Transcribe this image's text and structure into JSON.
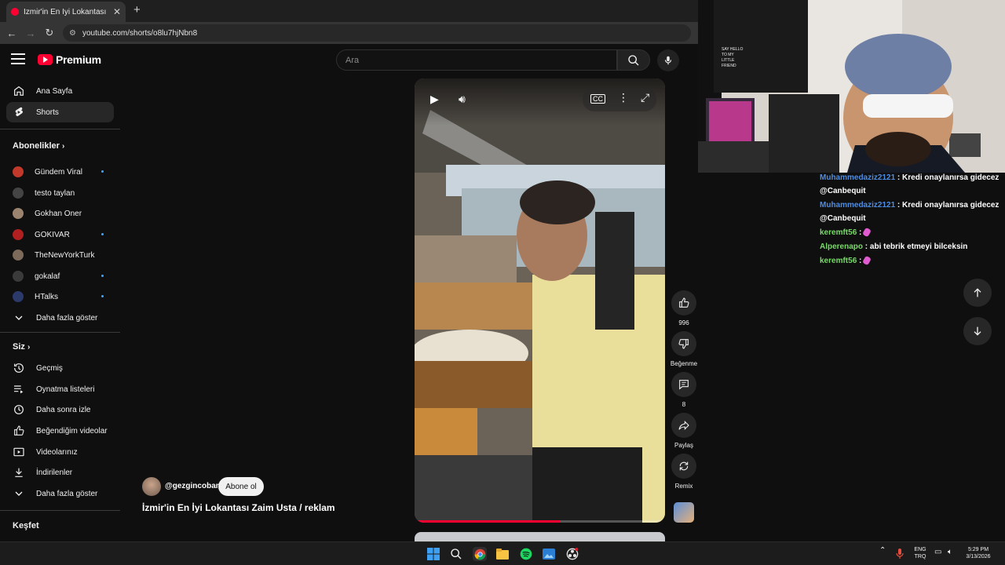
{
  "browser": {
    "tab_title": "İzmir'in En İyi Lokantası Zaim U",
    "tab_close": "✕",
    "new_tab": "+",
    "url": "youtube.com/shorts/o8lu7hjNbn8"
  },
  "youtube": {
    "logo_text": "Premium",
    "search_placeholder": "Ara"
  },
  "sidebar": {
    "main": [
      {
        "label": "Ana Sayfa",
        "icon": "home-icon"
      },
      {
        "label": "Shorts",
        "icon": "shorts-icon",
        "active": true
      }
    ],
    "subscriptions_title": "Abonelikler",
    "subscriptions": [
      {
        "label": "Gündem Viral",
        "color": "#c0392b",
        "dot": true
      },
      {
        "label": "testo taylan",
        "color": "#2f2f2f",
        "dot": false
      },
      {
        "label": "Gokhan Oner",
        "color": "#8a7766",
        "dot": false
      },
      {
        "label": "GOKIVAR",
        "color": "#b02020",
        "dot": true
      },
      {
        "label": "TheNewYorkTurk",
        "color": "#7c6a5a",
        "dot": false
      },
      {
        "label": "gokalaf",
        "color": "#2a2a2a",
        "dot": true
      },
      {
        "label": "HTalks",
        "color": "#2b3a6b",
        "dot": true
      }
    ],
    "show_more": "Daha fazla göster",
    "you_title": "Siz",
    "you_items": [
      {
        "label": "Geçmiş",
        "icon": "history-icon"
      },
      {
        "label": "Oynatma listeleri",
        "icon": "playlist-icon"
      },
      {
        "label": "Daha sonra izle",
        "icon": "watch-later-icon"
      },
      {
        "label": "Beğendiğim videolar",
        "icon": "liked-icon"
      },
      {
        "label": "Videolarınız",
        "icon": "your-videos-icon"
      },
      {
        "label": "İndirilenler",
        "icon": "download-icon"
      }
    ],
    "show_more_2": "Daha fazla göster",
    "explore_title": "Keşfet"
  },
  "video": {
    "progress": 0.58,
    "channel": "@gezgincoban",
    "subscribe_label": "Abone ol",
    "title": "İzmir'in En İyi Lokantası Zaim Usta / reklam"
  },
  "actions": {
    "like_count": "996",
    "dislike_label": "Beğenme",
    "comment_count": "8",
    "share_label": "Paylaş",
    "remix_label": "Remix"
  },
  "chat": [
    {
      "user": "Muhammedaziz2121",
      "text": "Kredi onaylanırsa gidecez @Canbequit",
      "color": "blue"
    },
    {
      "user": "Muhammedaziz2121",
      "text": "Kredi onaylanırsa gidecez @Canbequit",
      "color": "blue"
    },
    {
      "user": "keremft56",
      "text": "",
      "color": "green",
      "emote": true
    },
    {
      "user": "Alperenapo",
      "text": "abi tebrik etmeyi bilceksin",
      "color": "green"
    },
    {
      "user": "keremft56",
      "text": "",
      "color": "green",
      "emote": true
    }
  ],
  "taskbar": {
    "lang_top": "ENG",
    "lang_bottom": "TRQ",
    "time": "5:29 PM",
    "date": "3/13/2026"
  },
  "webcam": {
    "poster_text": "SAY HELLO TO MY LITTLE FRIEND"
  }
}
